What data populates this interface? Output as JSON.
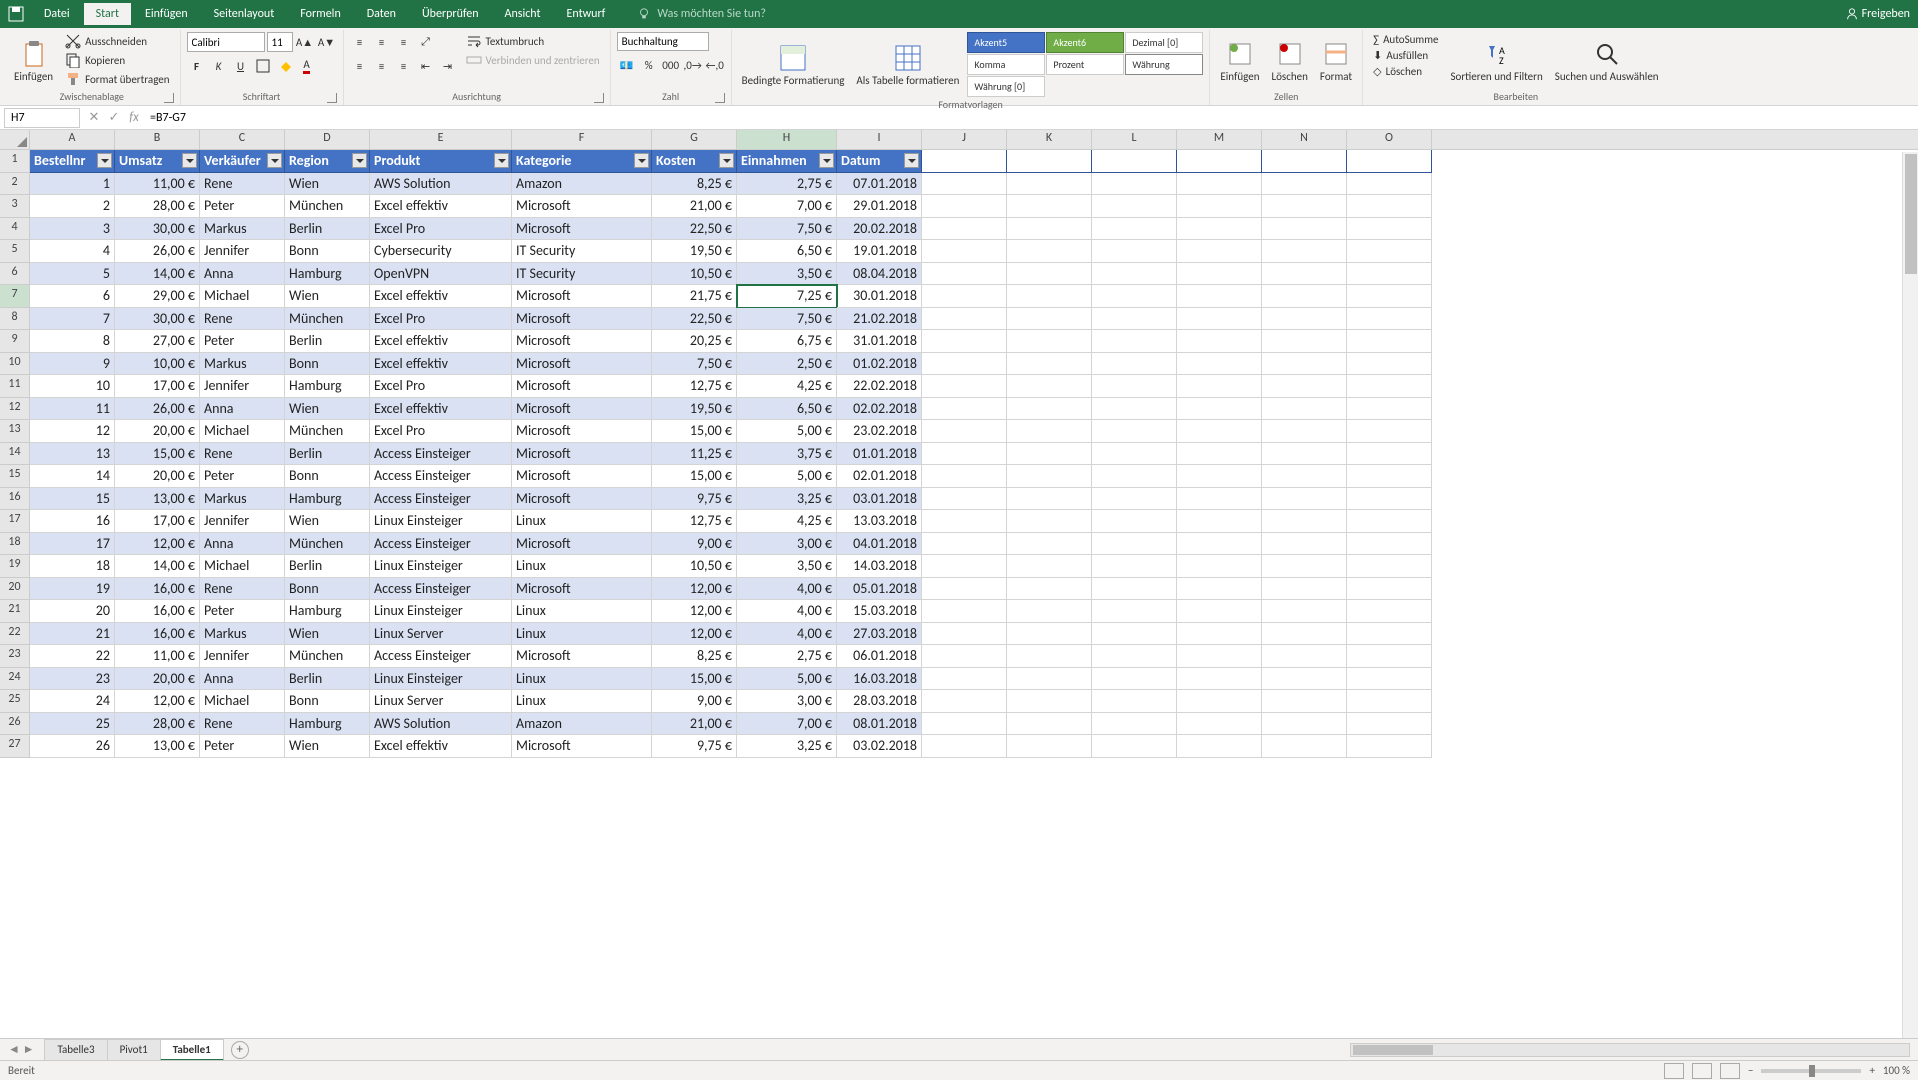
{
  "titlebar": {
    "tabs": [
      "Datei",
      "Start",
      "Einfügen",
      "Seitenlayout",
      "Formeln",
      "Daten",
      "Überprüfen",
      "Ansicht",
      "Entwurf"
    ],
    "active_tab": 1,
    "search_placeholder": "Was möchten Sie tun?",
    "share": "Freigeben"
  },
  "ribbon": {
    "paste": "Einfügen",
    "cut": "Ausschneiden",
    "copy": "Kopieren",
    "format_painter": "Format übertragen",
    "clipboard_grp": "Zwischenablage",
    "font_name": "Calibri",
    "font_size": "11",
    "font_grp": "Schriftart",
    "wrap": "Textumbruch",
    "merge": "Verbinden und zentrieren",
    "align_grp": "Ausrichtung",
    "number_format": "Buchhaltung",
    "number_grp": "Zahl",
    "cond_fmt": "Bedingte Formatierung",
    "as_table": "Als Tabelle formatieren",
    "styles": {
      "akzent5": "Akzent5",
      "akzent6": "Akzent6",
      "dezimal": "Dezimal [0]",
      "komma": "Komma",
      "prozent": "Prozent",
      "wahrung": "Währung",
      "wahrung0": "Währung [0]"
    },
    "styles_grp": "Formatvorlagen",
    "insert": "Einfügen",
    "delete": "Löschen",
    "format": "Format",
    "cells_grp": "Zellen",
    "autosum": "AutoSumme",
    "fill": "Ausfüllen",
    "clear": "Löschen",
    "sort": "Sortieren und Filtern",
    "find": "Suchen und Auswählen",
    "edit_grp": "Bearbeiten"
  },
  "formula_bar": {
    "name_box": "H7",
    "formula": "=B7-G7"
  },
  "columns": [
    "A",
    "B",
    "C",
    "D",
    "E",
    "F",
    "G",
    "H",
    "I",
    "J",
    "K",
    "L",
    "M",
    "N",
    "O"
  ],
  "selected_col": "H",
  "selected_row": 7,
  "headers": [
    "Bestellnr",
    "Umsatz",
    "Verkäufer",
    "Region",
    "Produkt",
    "Kategorie",
    "Kosten",
    "Einnahmen",
    "Datum"
  ],
  "rows": [
    [
      1,
      "11,00 €",
      "Rene",
      "Wien",
      "AWS Solution",
      "Amazon",
      "8,25 €",
      "2,75 €",
      "07.01.2018"
    ],
    [
      2,
      "28,00 €",
      "Peter",
      "München",
      "Excel effektiv",
      "Microsoft",
      "21,00 €",
      "7,00 €",
      "29.01.2018"
    ],
    [
      3,
      "30,00 €",
      "Markus",
      "Berlin",
      "Excel Pro",
      "Microsoft",
      "22,50 €",
      "7,50 €",
      "20.02.2018"
    ],
    [
      4,
      "26,00 €",
      "Jennifer",
      "Bonn",
      "Cybersecurity",
      "IT Security",
      "19,50 €",
      "6,50 €",
      "19.01.2018"
    ],
    [
      5,
      "14,00 €",
      "Anna",
      "Hamburg",
      "OpenVPN",
      "IT Security",
      "10,50 €",
      "3,50 €",
      "08.04.2018"
    ],
    [
      6,
      "29,00 €",
      "Michael",
      "Wien",
      "Excel effektiv",
      "Microsoft",
      "21,75 €",
      "7,25 €",
      "30.01.2018"
    ],
    [
      7,
      "30,00 €",
      "Rene",
      "München",
      "Excel Pro",
      "Microsoft",
      "22,50 €",
      "7,50 €",
      "21.02.2018"
    ],
    [
      8,
      "27,00 €",
      "Peter",
      "Berlin",
      "Excel effektiv",
      "Microsoft",
      "20,25 €",
      "6,75 €",
      "31.01.2018"
    ],
    [
      9,
      "10,00 €",
      "Markus",
      "Bonn",
      "Excel effektiv",
      "Microsoft",
      "7,50 €",
      "2,50 €",
      "01.02.2018"
    ],
    [
      10,
      "17,00 €",
      "Jennifer",
      "Hamburg",
      "Excel Pro",
      "Microsoft",
      "12,75 €",
      "4,25 €",
      "22.02.2018"
    ],
    [
      11,
      "26,00 €",
      "Anna",
      "Wien",
      "Excel effektiv",
      "Microsoft",
      "19,50 €",
      "6,50 €",
      "02.02.2018"
    ],
    [
      12,
      "20,00 €",
      "Michael",
      "München",
      "Excel Pro",
      "Microsoft",
      "15,00 €",
      "5,00 €",
      "23.02.2018"
    ],
    [
      13,
      "15,00 €",
      "Rene",
      "Berlin",
      "Access Einsteiger",
      "Microsoft",
      "11,25 €",
      "3,75 €",
      "01.01.2018"
    ],
    [
      14,
      "20,00 €",
      "Peter",
      "Bonn",
      "Access Einsteiger",
      "Microsoft",
      "15,00 €",
      "5,00 €",
      "02.01.2018"
    ],
    [
      15,
      "13,00 €",
      "Markus",
      "Hamburg",
      "Access Einsteiger",
      "Microsoft",
      "9,75 €",
      "3,25 €",
      "03.01.2018"
    ],
    [
      16,
      "17,00 €",
      "Jennifer",
      "Wien",
      "Linux Einsteiger",
      "Linux",
      "12,75 €",
      "4,25 €",
      "13.03.2018"
    ],
    [
      17,
      "12,00 €",
      "Anna",
      "München",
      "Access Einsteiger",
      "Microsoft",
      "9,00 €",
      "3,00 €",
      "04.01.2018"
    ],
    [
      18,
      "14,00 €",
      "Michael",
      "Berlin",
      "Linux Einsteiger",
      "Linux",
      "10,50 €",
      "3,50 €",
      "14.03.2018"
    ],
    [
      19,
      "16,00 €",
      "Rene",
      "Bonn",
      "Access Einsteiger",
      "Microsoft",
      "12,00 €",
      "4,00 €",
      "05.01.2018"
    ],
    [
      20,
      "16,00 €",
      "Peter",
      "Hamburg",
      "Linux Einsteiger",
      "Linux",
      "12,00 €",
      "4,00 €",
      "15.03.2018"
    ],
    [
      21,
      "16,00 €",
      "Markus",
      "Wien",
      "Linux Server",
      "Linux",
      "12,00 €",
      "4,00 €",
      "27.03.2018"
    ],
    [
      22,
      "11,00 €",
      "Jennifer",
      "München",
      "Access Einsteiger",
      "Microsoft",
      "8,25 €",
      "2,75 €",
      "06.01.2018"
    ],
    [
      23,
      "20,00 €",
      "Anna",
      "Berlin",
      "Linux Einsteiger",
      "Linux",
      "15,00 €",
      "5,00 €",
      "16.03.2018"
    ],
    [
      24,
      "12,00 €",
      "Michael",
      "Bonn",
      "Linux Server",
      "Linux",
      "9,00 €",
      "3,00 €",
      "28.03.2018"
    ],
    [
      25,
      "28,00 €",
      "Rene",
      "Hamburg",
      "AWS Solution",
      "Amazon",
      "21,00 €",
      "7,00 €",
      "08.01.2018"
    ],
    [
      26,
      "13,00 €",
      "Peter",
      "Wien",
      "Excel effektiv",
      "Microsoft",
      "9,75 €",
      "3,25 €",
      "03.02.2018"
    ]
  ],
  "sheets": [
    "Tabelle3",
    "Pivot1",
    "Tabelle1"
  ],
  "active_sheet": 2,
  "status": "Bereit",
  "zoom": "100 %"
}
